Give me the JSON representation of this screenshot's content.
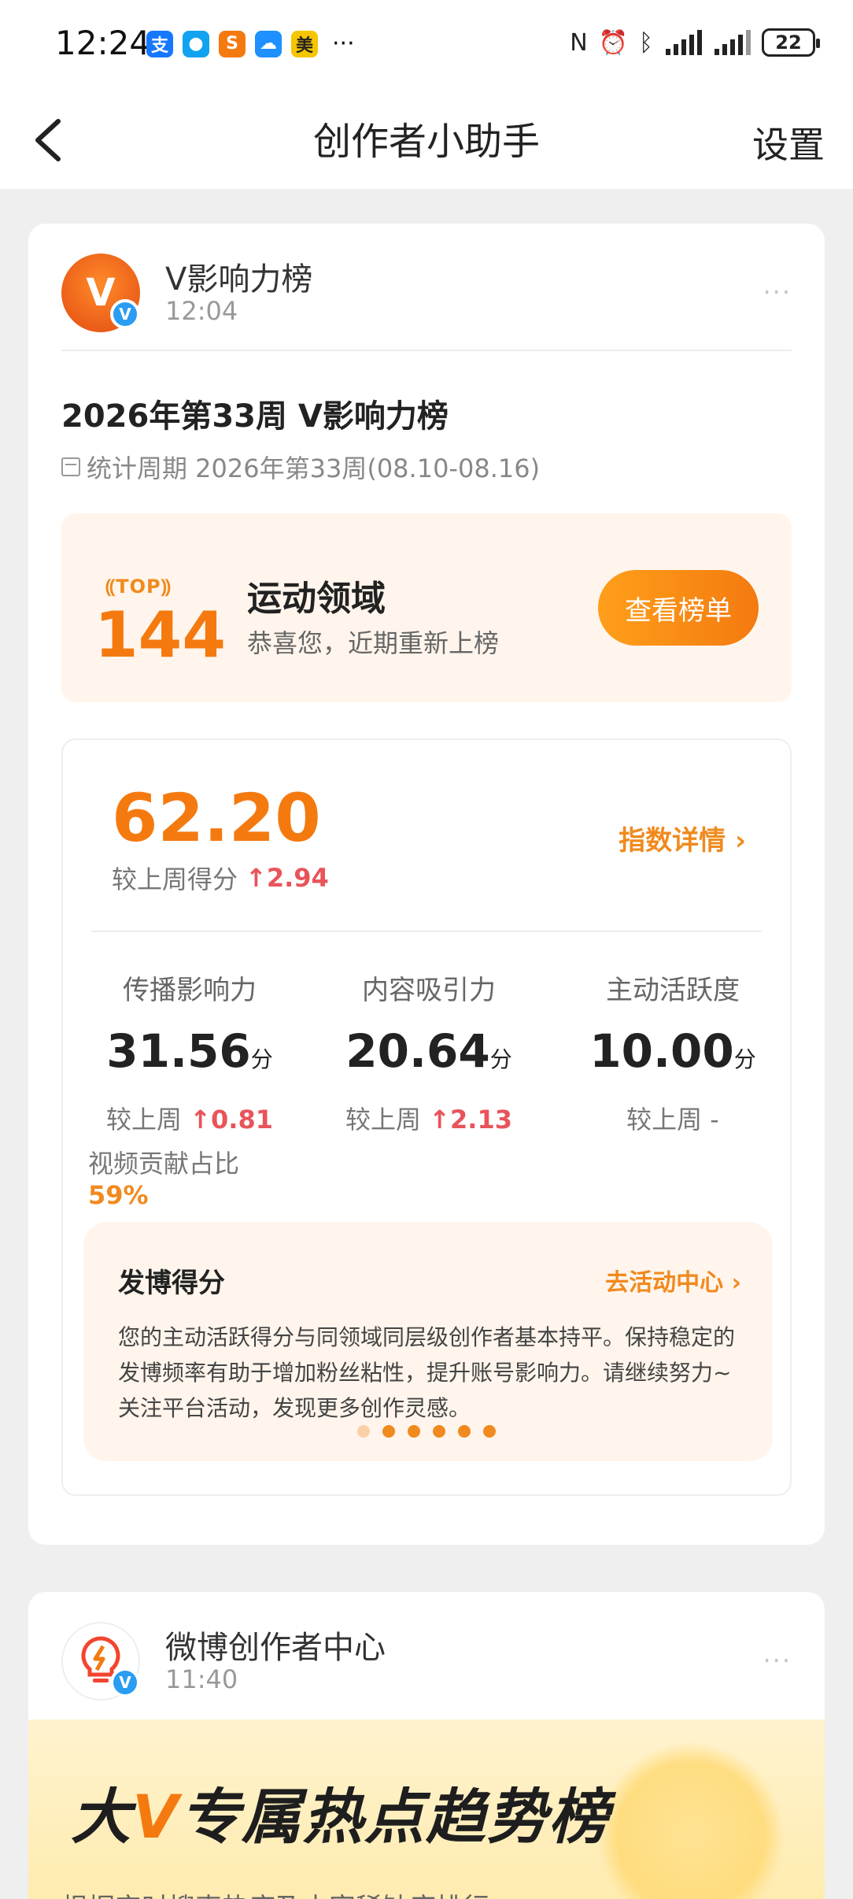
{
  "status_bar": {
    "time": "12:24",
    "apps": [
      {
        "glyph": "支",
        "color": "#1677ff"
      },
      {
        "glyph": "●",
        "color": "#12a3f0"
      },
      {
        "glyph": "S",
        "color": "#f47a10"
      },
      {
        "glyph": "☁",
        "color": "#1e90ff"
      },
      {
        "glyph": "美",
        "color": "#f5c500"
      }
    ],
    "more": "···",
    "battery": "22"
  },
  "nav": {
    "title": "创作者小助手",
    "settings": "设置"
  },
  "post1": {
    "account_name": "V影响力榜",
    "time": "12:04",
    "more": "···",
    "rank_title": "2026年第33周 V影响力榜",
    "period": "统计周期 2026年第33周(08.10-08.16)",
    "top_badge": "TOP",
    "top_number": "144",
    "field": "运动领域",
    "congrats": "恭喜您，近期重新上榜",
    "view_button": "查看榜单",
    "score": "62.20",
    "compare_label": "较上周得分",
    "compare_value": "2.94",
    "detail_link": "指数详情",
    "metrics": [
      {
        "label": "传播影响力",
        "value": "31.56",
        "unit": "分",
        "cmp_label": "较上周",
        "cmp_value": "0.81"
      },
      {
        "label": "内容吸引力",
        "value": "20.64",
        "unit": "分",
        "cmp_label": "较上周",
        "cmp_value": "2.13"
      },
      {
        "label": "主动活跃度",
        "value": "10.00",
        "unit": "分",
        "cmp_label": "较上周 -",
        "cmp_value": ""
      }
    ],
    "video_share_label": "视频贡献占比",
    "video_share_value": "59%",
    "tip_title": "发博得分",
    "tip_link": "去活动中心",
    "tip_text": "您的主动活跃得分与同领域同层级创作者基本持平。保持稳定的发博频率有助于增加粉丝粘性，提升账号影响力。请继续努力~关注平台活动，发现更多创作灵感。"
  },
  "post2": {
    "account_name": "微博创作者中心",
    "time": "11:40",
    "more": "···",
    "banner_title_a": "大",
    "banner_title_v": "V",
    "banner_title_b": "专属热点趋势榜",
    "banner_sub": "根据实时搜索热度及内容稀缺度排行:"
  },
  "colors": {
    "accent": "#f47a10",
    "up": "#e8545a",
    "verified": "#2a9cf2"
  }
}
